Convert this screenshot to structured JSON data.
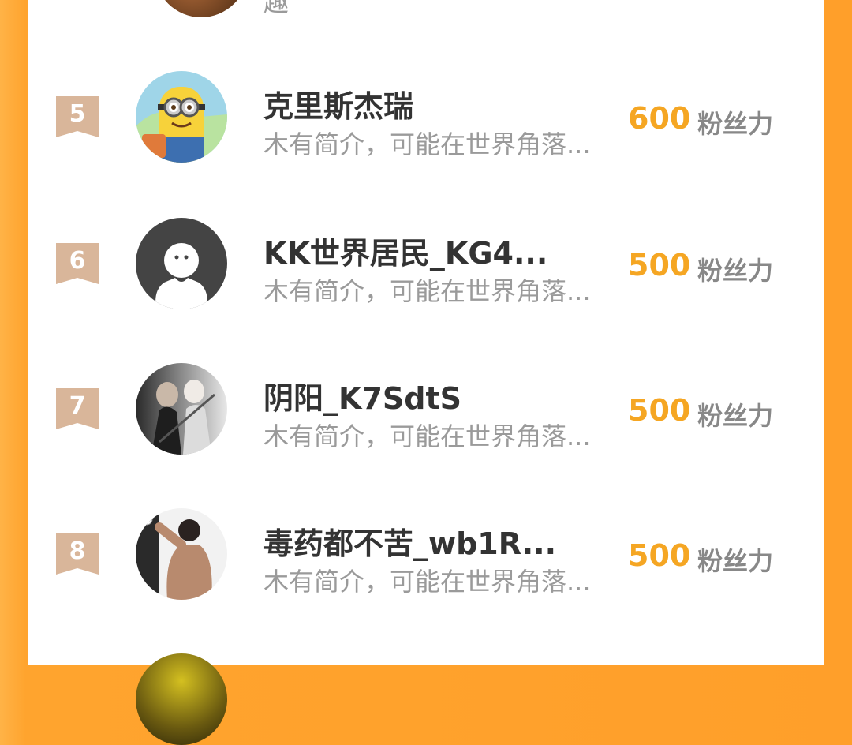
{
  "top_partial": {
    "bio_fragment": "趣"
  },
  "rows": [
    {
      "rank": "5",
      "name": "克里斯杰瑞",
      "bio": "木有简介，可能在世界角落...",
      "score": "600",
      "unit": "粉丝力",
      "avatar": "minion-avatar"
    },
    {
      "rank": "6",
      "name": "KK世界居民_KG4...",
      "bio": "木有简介，可能在世界角落...",
      "score": "500",
      "unit": "粉丝力",
      "avatar": "default-avatar"
    },
    {
      "rank": "7",
      "name": "阴阳_K7SdtS",
      "bio": "木有简介，可能在世界角落...",
      "score": "500",
      "unit": "粉丝力",
      "avatar": "swordsman-avatar"
    },
    {
      "rank": "8",
      "name": "毒药都不苦_wb1R...",
      "bio": "木有简介，可能在世界角落...",
      "score": "500",
      "unit": "粉丝力",
      "avatar": "muscle-avatar"
    }
  ],
  "colors": {
    "accent": "#f5a623",
    "rank_badge": "#d9b69a",
    "background": "#ff9f2a"
  }
}
